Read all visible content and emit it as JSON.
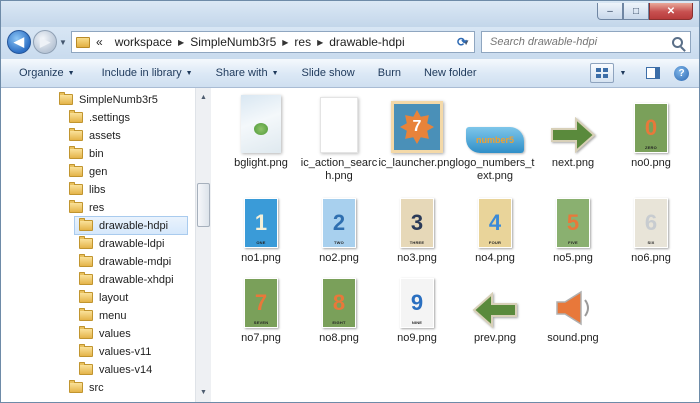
{
  "window": {
    "controls": {
      "minimize": "–",
      "maximize": "□",
      "close": "✕"
    }
  },
  "nav": {
    "back_icon": "back-arrow-icon",
    "forward_icon": "forward-arrow-icon",
    "breadcrumb_prefix": "«",
    "breadcrumb": [
      "workspace",
      "SimpleNumb3r5",
      "res",
      "drawable-hdpi"
    ],
    "search_placeholder": "Search drawable-hdpi"
  },
  "toolbar": {
    "organize": "Organize",
    "include_in_library": "Include in library",
    "share_with": "Share with",
    "slide_show": "Slide show",
    "burn": "Burn",
    "new_folder": "New folder"
  },
  "tree": {
    "items": [
      {
        "label": "SimpleNumb3r5",
        "selected": false
      },
      {
        "label": ".settings",
        "selected": false
      },
      {
        "label": "assets",
        "selected": false
      },
      {
        "label": "bin",
        "selected": false
      },
      {
        "label": "gen",
        "selected": false
      },
      {
        "label": "libs",
        "selected": false
      },
      {
        "label": "res",
        "selected": false
      },
      {
        "label": "drawable-hdpi",
        "selected": true
      },
      {
        "label": "drawable-ldpi",
        "selected": false
      },
      {
        "label": "drawable-mdpi",
        "selected": false
      },
      {
        "label": "drawable-xhdpi",
        "selected": false
      },
      {
        "label": "layout",
        "selected": false
      },
      {
        "label": "menu",
        "selected": false
      },
      {
        "label": "values",
        "selected": false
      },
      {
        "label": "values-v11",
        "selected": false
      },
      {
        "label": "values-v14",
        "selected": false
      },
      {
        "label": "src",
        "selected": false
      }
    ]
  },
  "files": [
    {
      "name": "bglight.png",
      "kind": "bglight"
    },
    {
      "name": "ic_action_search.png",
      "kind": "plain"
    },
    {
      "name": "ic_launcher.png",
      "kind": "launcher",
      "glyph": "7"
    },
    {
      "name": "logo_numbers_text.png",
      "kind": "logo",
      "glyph": "number5"
    },
    {
      "name": "next.png",
      "kind": "arrow-right",
      "color": "#5a8a3c"
    },
    {
      "name": "no0.png",
      "kind": "card",
      "glyph": "0",
      "word": "ZERO",
      "bg": "#7aa05a",
      "fg": "#e8783a"
    },
    {
      "name": "no1.png",
      "kind": "card",
      "glyph": "1",
      "word": "ONE",
      "bg": "#3a9bd8",
      "fg": "#f4f0d8"
    },
    {
      "name": "no2.png",
      "kind": "card",
      "glyph": "2",
      "word": "TWO",
      "bg": "#a8d0ee",
      "fg": "#2f6fb0"
    },
    {
      "name": "no3.png",
      "kind": "card",
      "glyph": "3",
      "word": "THREE",
      "bg": "#e6d8b8",
      "fg": "#2a3a58"
    },
    {
      "name": "no4.png",
      "kind": "card",
      "glyph": "4",
      "word": "FOUR",
      "bg": "#e9d49a",
      "fg": "#3a8ad8"
    },
    {
      "name": "no5.png",
      "kind": "card",
      "glyph": "5",
      "word": "FIVE",
      "bg": "#8ab070",
      "fg": "#e8783a"
    },
    {
      "name": "no6.png",
      "kind": "card",
      "glyph": "6",
      "word": "SIX",
      "bg": "#e8e4d8",
      "fg": "#c8ccd0"
    },
    {
      "name": "no7.png",
      "kind": "card",
      "glyph": "7",
      "word": "SEVEN",
      "bg": "#7aa05a",
      "fg": "#e8783a"
    },
    {
      "name": "no8.png",
      "kind": "card",
      "glyph": "8",
      "word": "EIGHT",
      "bg": "#7aa05a",
      "fg": "#e8783a"
    },
    {
      "name": "no9.png",
      "kind": "card",
      "glyph": "9",
      "word": "NINE",
      "bg": "#f4f4f4",
      "fg": "#2a6fc0"
    },
    {
      "name": "prev.png",
      "kind": "arrow-left",
      "color": "#5a8a3c"
    },
    {
      "name": "sound.png",
      "kind": "speaker",
      "color": "#e8783a"
    }
  ]
}
